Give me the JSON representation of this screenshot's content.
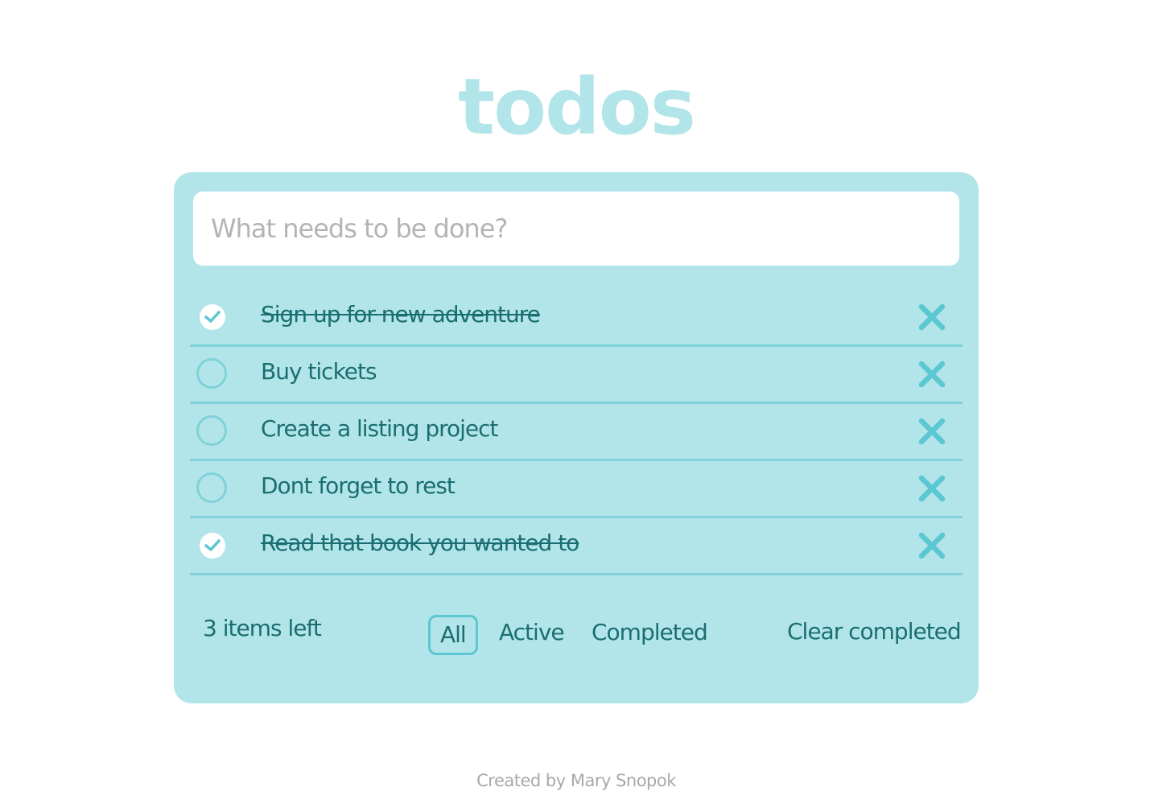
{
  "app": {
    "title": "todos",
    "input_placeholder": "What needs to be done?"
  },
  "todos": [
    {
      "label": "Sign up for new adventure",
      "completed": true
    },
    {
      "label": "Buy tickets",
      "completed": false
    },
    {
      "label": "Create a listing project",
      "completed": false
    },
    {
      "label": "Dont forget to rest",
      "completed": false
    },
    {
      "label": "Read that book you wanted to",
      "completed": true
    }
  ],
  "footer": {
    "items_left": "3 items left",
    "filters": [
      "All",
      "Active",
      "Completed"
    ],
    "selected_filter": "All",
    "clear_completed": "Clear completed"
  },
  "credit": "Created by Mary Snopok",
  "colors": {
    "accent": "#b2e5e9",
    "divider": "#7fd2da",
    "icon": "#5bc7d1",
    "text": "#1a6e72"
  },
  "icons": {
    "check": "check-icon",
    "remove": "close-icon"
  }
}
